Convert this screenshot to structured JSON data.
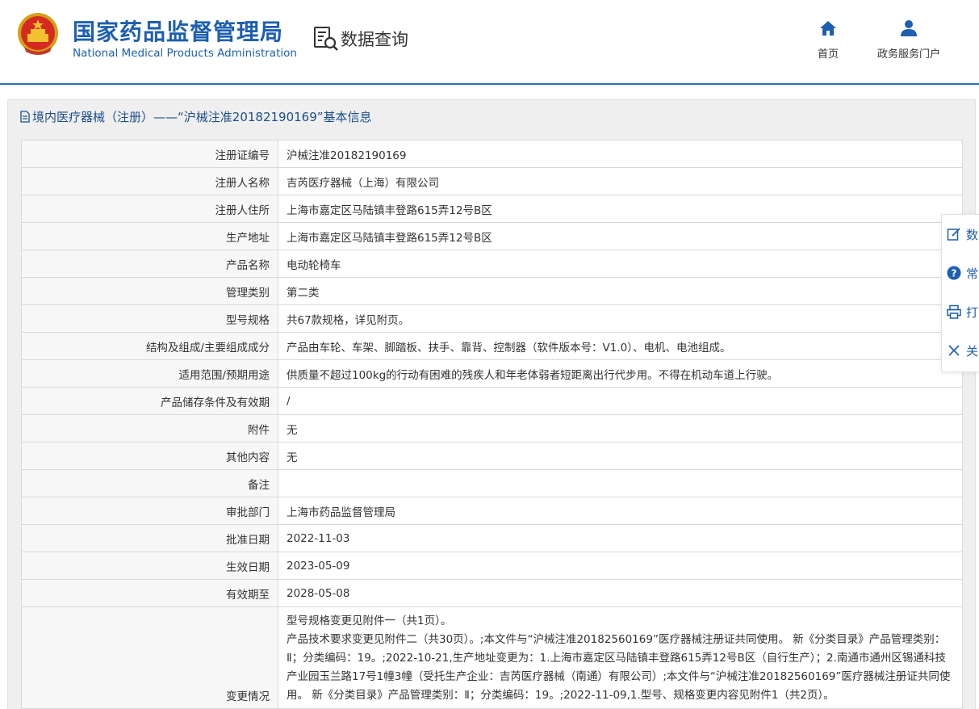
{
  "header": {
    "brand_cn": "国家药品监督管理局",
    "brand_en": "National Medical Products Administration",
    "query_label": "数据查询",
    "nav": [
      {
        "label": "首页",
        "icon": "home-icon"
      },
      {
        "label": "政务服务门户",
        "icon": "user-icon"
      }
    ],
    "brand_color": "#1d5fb0"
  },
  "page": {
    "title": "境内医疗器械（注册）——“沪械注准20182190169”基本信息"
  },
  "fields": [
    {
      "label": "注册证编号",
      "value": "沪械注准20182190169"
    },
    {
      "label": "注册人名称",
      "value": "吉芮医疗器械（上海）有限公司"
    },
    {
      "label": "注册人住所",
      "value": "上海市嘉定区马陆镇丰登路615弄12号B区"
    },
    {
      "label": "生产地址",
      "value": "上海市嘉定区马陆镇丰登路615弄12号B区"
    },
    {
      "label": "产品名称",
      "value": "电动轮椅车"
    },
    {
      "label": "管理类别",
      "value": "第二类"
    },
    {
      "label": "型号规格",
      "value": "共67款规格，详见附页。"
    },
    {
      "label": "结构及组成/主要组成成分",
      "value": "产品由车轮、车架、脚踏板、扶手、靠背、控制器（软件版本号：V1.0）、电机、电池组成。"
    },
    {
      "label": "适用范围/预期用途",
      "value": "供质量不超过100kg的行动有困难的残疾人和年老体弱者短距离出行代步用。不得在机动车道上行驶。"
    },
    {
      "label": "产品储存条件及有效期",
      "value": "/"
    },
    {
      "label": "附件",
      "value": "无"
    },
    {
      "label": "其他内容",
      "value": "无"
    },
    {
      "label": "备注",
      "value": ""
    },
    {
      "label": "审批部门",
      "value": "上海市药品监督管理局"
    },
    {
      "label": "批准日期",
      "value": "2022-11-03"
    },
    {
      "label": "生效日期",
      "value": "2023-05-09"
    },
    {
      "label": "有效期至",
      "value": "2028-05-08"
    }
  ],
  "change": {
    "label": "变更情况",
    "lines": [
      "型号规格变更见附件一（共1页）。",
      "产品技术要求变更见附件二（共30页）。;本文件与“沪械注准20182560169”医疗器械注册证共同使用。 新《分类目录》产品管理类别：Ⅱ；分类编码：19。;2022-10-21,生产地址变更为：1.上海市嘉定区马陆镇丰登路615弄12号B区（自行生产）；2.南通市通州区锡通科技产业园玉兰路17号1幢3幢（受托生产企业：吉芮医疗器械（南通）有限公司）;本文件与“沪械注准20182560169”医疗器械注册证共同使用。 新《分类目录》产品管理类别：Ⅱ；分类编码：19。;2022-11-09,1.型号、规格变更内容见附件1（共2页）。"
    ]
  },
  "side_tools": [
    {
      "label": "数",
      "icon": "edit-icon"
    },
    {
      "label": "常",
      "icon": "help-icon"
    },
    {
      "label": "打",
      "icon": "print-icon"
    },
    {
      "label": "关",
      "icon": "close-icon"
    }
  ]
}
